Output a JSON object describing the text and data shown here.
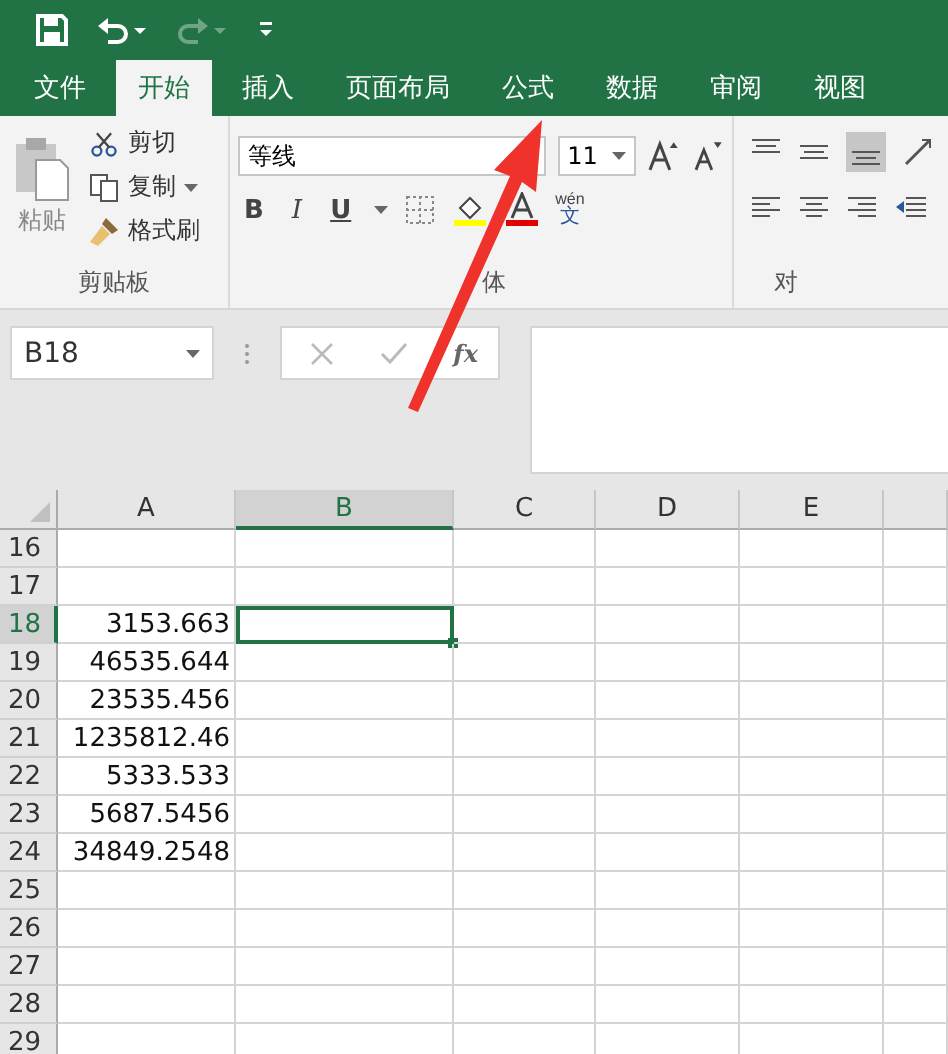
{
  "quick_access": [
    {
      "kind": "save",
      "disabled": false
    },
    {
      "kind": "undo",
      "disabled": false
    },
    {
      "kind": "redo",
      "disabled": true
    },
    {
      "kind": "customize",
      "disabled": false
    }
  ],
  "tabs": [
    {
      "label": "文件",
      "selected": false
    },
    {
      "label": "开始",
      "selected": true
    },
    {
      "label": "插入",
      "selected": false
    },
    {
      "label": "页面布局",
      "selected": false
    },
    {
      "label": "公式",
      "selected": false
    },
    {
      "label": "数据",
      "selected": false
    },
    {
      "label": "审阅",
      "selected": false
    },
    {
      "label": "视图",
      "selected": false
    }
  ],
  "ribbon": {
    "clipboard": {
      "paste": "粘贴",
      "cut": "剪切",
      "copy": "复制",
      "format_painter": "格式刷",
      "group": "剪贴板"
    },
    "font": {
      "name": "等线",
      "size": "11",
      "bold": "B",
      "italic": "I",
      "underline": "U",
      "phonetic": "wén",
      "phonetic_char": "文",
      "group": "体"
    },
    "alignment": {
      "group": "对"
    }
  },
  "formula_bar": {
    "name_box": "B18",
    "fx": "fx"
  },
  "columns": [
    {
      "label": "A",
      "selected": false
    },
    {
      "label": "B",
      "selected": true
    },
    {
      "label": "C",
      "selected": false
    },
    {
      "label": "D",
      "selected": false
    },
    {
      "label": "E",
      "selected": false
    }
  ],
  "rows": [
    {
      "label": "16",
      "selected": false
    },
    {
      "label": "17",
      "selected": false
    },
    {
      "label": "18",
      "selected": true,
      "a": "3153.663"
    },
    {
      "label": "19",
      "selected": false,
      "a": "46535.644"
    },
    {
      "label": "20",
      "selected": false,
      "a": "23535.456"
    },
    {
      "label": "21",
      "selected": false,
      "a": "1235812.46"
    },
    {
      "label": "22",
      "selected": false,
      "a": "5333.533"
    },
    {
      "label": "23",
      "selected": false,
      "a": "5687.5456"
    },
    {
      "label": "24",
      "selected": false,
      "a": "34849.2548"
    },
    {
      "label": "25",
      "selected": false
    },
    {
      "label": "26",
      "selected": false
    },
    {
      "label": "27",
      "selected": false
    },
    {
      "label": "28",
      "selected": false
    },
    {
      "label": "29",
      "selected": false
    }
  ]
}
